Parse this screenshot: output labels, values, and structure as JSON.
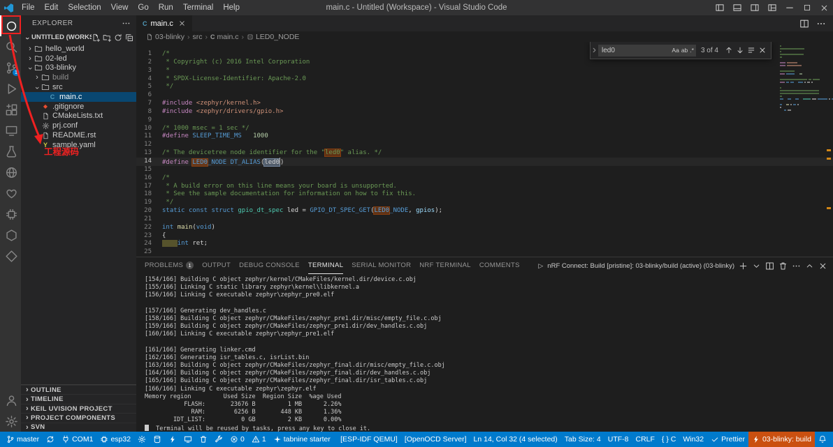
{
  "colors": {
    "statusbar_background": "#007acc",
    "build_badge_background": "#ca5010",
    "annotation_red": "#f02121",
    "activity_badge_blue": "#007acc",
    "find_current_match": "#515c6a",
    "find_match_orange": "rgba(234,92,0,0.33)",
    "selected_row_blue": "#094771"
  },
  "title_bar": {
    "app_title": "main.c - Untitled (Workspace) - Visual Studio Code",
    "menus": [
      "File",
      "Edit",
      "Selection",
      "View",
      "Go",
      "Run",
      "Terminal",
      "Help"
    ]
  },
  "activity_bar": {
    "top": [
      {
        "name": "explorer",
        "active": true
      },
      {
        "name": "search"
      },
      {
        "name": "source-control",
        "badge": "1"
      },
      {
        "name": "run-debug"
      },
      {
        "name": "extensions"
      },
      {
        "name": "remote-explorer"
      },
      {
        "name": "test-beaker"
      },
      {
        "name": "nrf-connect"
      },
      {
        "name": "platformio"
      },
      {
        "name": "device-chip"
      },
      {
        "name": "keil"
      },
      {
        "name": "kite"
      }
    ],
    "bottom": [
      {
        "name": "accounts"
      },
      {
        "name": "settings-gear"
      }
    ]
  },
  "sidebar": {
    "title": "EXPLORER",
    "workspace_label": "UNTITLED (WORKSPACE)",
    "tree": [
      {
        "label": "hello_world",
        "indent": 0,
        "kind": "folder",
        "expanded": false
      },
      {
        "label": "02-led",
        "indent": 0,
        "kind": "folder",
        "expanded": false
      },
      {
        "label": "03-blinky",
        "indent": 0,
        "kind": "folder",
        "expanded": true
      },
      {
        "label": "build",
        "indent": 1,
        "kind": "folder",
        "expanded": false,
        "dim": true
      },
      {
        "label": "src",
        "indent": 1,
        "kind": "folder",
        "expanded": true
      },
      {
        "label": "main.c",
        "indent": 2,
        "kind": "c",
        "selected": true
      },
      {
        "label": ".gitignore",
        "indent": 1,
        "kind": "git"
      },
      {
        "label": "CMakeLists.txt",
        "indent": 1,
        "kind": "doc"
      },
      {
        "label": "prj.conf",
        "indent": 1,
        "kind": "conf"
      },
      {
        "label": "README.rst",
        "indent": 1,
        "kind": "doc"
      },
      {
        "label": "sample.yaml",
        "indent": 1,
        "kind": "yaml"
      }
    ],
    "sections": [
      "OUTLINE",
      "TIMELINE",
      "KEIL UVISION PROJECT",
      "PROJECT COMPONENTS",
      "SVN"
    ]
  },
  "annotation": {
    "label": "工程源码"
  },
  "editor": {
    "tab": {
      "label": "main.c"
    },
    "breadcrumbs": [
      "03-blinky",
      "src",
      "main.c",
      "LED0_NODE"
    ],
    "find": {
      "value": "led0",
      "results": "3 of 4",
      "toggles": [
        "Aa",
        "ab",
        ".*"
      ]
    },
    "code": [
      {
        "n": 1,
        "s": [
          [
            "/*",
            "cm"
          ]
        ]
      },
      {
        "n": 2,
        "s": [
          [
            " * Copyright (c) 2016 Intel Corporation",
            "cm"
          ]
        ]
      },
      {
        "n": 3,
        "s": [
          [
            " *",
            "cm"
          ]
        ]
      },
      {
        "n": 4,
        "s": [
          [
            " * SPDX-License-Identifier: Apache-2.0",
            "cm"
          ]
        ]
      },
      {
        "n": 5,
        "s": [
          [
            " */",
            "cm"
          ]
        ]
      },
      {
        "n": 6,
        "s": []
      },
      {
        "n": 7,
        "s": [
          [
            "#include ",
            "pp"
          ],
          [
            "<zephyr/kernel.h>",
            "str"
          ]
        ]
      },
      {
        "n": 8,
        "s": [
          [
            "#include ",
            "pp"
          ],
          [
            "<zephyr/drivers/gpio.h>",
            "str"
          ]
        ]
      },
      {
        "n": 9,
        "s": []
      },
      {
        "n": 10,
        "s": [
          [
            "/* 1000 msec = 1 sec */",
            "cm"
          ]
        ]
      },
      {
        "n": 11,
        "s": [
          [
            "#define ",
            "pp"
          ],
          [
            "SLEEP_TIME_MS",
            "mac"
          ],
          [
            "   ",
            "pl"
          ],
          [
            "1000",
            "num"
          ]
        ]
      },
      {
        "n": 12,
        "s": []
      },
      {
        "n": 13,
        "s": [
          [
            "/* The devicetree node identifier for the \"",
            "cm"
          ],
          [
            "led0",
            "cm match"
          ],
          [
            "\" alias. */",
            "cm"
          ]
        ]
      },
      {
        "n": 14,
        "cur": true,
        "s": [
          [
            "#define ",
            "pp"
          ],
          [
            "LED0",
            "mac match"
          ],
          [
            "_NODE",
            "mac"
          ],
          [
            " ",
            "pl"
          ],
          [
            "DT_ALIAS",
            "mac"
          ],
          [
            "(",
            "pl"
          ],
          [
            "led0",
            "pl cursel"
          ],
          [
            ")",
            "pl"
          ]
        ]
      },
      {
        "n": 15,
        "s": []
      },
      {
        "n": 16,
        "s": [
          [
            "/*",
            "cm"
          ]
        ]
      },
      {
        "n": 17,
        "s": [
          [
            " * A build error on this line means your board is unsupported.",
            "cm"
          ]
        ]
      },
      {
        "n": 18,
        "s": [
          [
            " * See the sample documentation for information on how to fix this.",
            "cm"
          ]
        ]
      },
      {
        "n": 19,
        "s": [
          [
            " */",
            "cm"
          ]
        ]
      },
      {
        "n": 20,
        "s": [
          [
            "static",
            "kw"
          ],
          [
            " ",
            "pl"
          ],
          [
            "const",
            "kw"
          ],
          [
            " ",
            "pl"
          ],
          [
            "struct",
            "kw"
          ],
          [
            " ",
            "pl"
          ],
          [
            "gpio_dt_spec",
            "typ"
          ],
          [
            " led = ",
            "pl"
          ],
          [
            "GPIO_DT_SPEC_GET",
            "mac"
          ],
          [
            "(",
            "pl"
          ],
          [
            "LED0",
            "mac match"
          ],
          [
            "_NODE",
            "mac"
          ],
          [
            ", ",
            "pl"
          ],
          [
            "gpios",
            "var"
          ],
          [
            ");",
            "pl"
          ]
        ]
      },
      {
        "n": 21,
        "s": []
      },
      {
        "n": 22,
        "s": [
          [
            "int",
            "kw"
          ],
          [
            " ",
            "pl"
          ],
          [
            "main",
            "fn"
          ],
          [
            "(",
            "pl"
          ],
          [
            "void",
            "kw"
          ],
          [
            ")",
            "pl"
          ]
        ]
      },
      {
        "n": 23,
        "s": [
          [
            "{",
            "pl"
          ]
        ]
      },
      {
        "n": 24,
        "s": [
          [
            "    ",
            "ws"
          ],
          [
            "int",
            "kw"
          ],
          [
            " ret;",
            "pl"
          ]
        ]
      },
      {
        "n": 25,
        "s": []
      }
    ]
  },
  "panel": {
    "tabs": [
      {
        "label": "PROBLEMS",
        "badge": "1"
      },
      {
        "label": "OUTPUT"
      },
      {
        "label": "DEBUG CONSOLE"
      },
      {
        "label": "TERMINAL",
        "active": true
      },
      {
        "label": "SERIAL MONITOR"
      },
      {
        "label": "NRF TERMINAL"
      },
      {
        "label": "COMMENTS"
      }
    ],
    "terminal_title": "nRF Connect: Build [pristine]: 03-blinky/build (active) (03-blinky)",
    "terminal_lines": [
      "[154/166] Building C object zephyr/kernel/CMakeFiles/kernel.dir/device.c.obj",
      "[155/166] Linking C static library zephyr\\kernel\\libkernel.a",
      "[156/166] Linking C executable zephyr\\zephyr_pre0.elf",
      "",
      "[157/166] Generating dev_handles.c",
      "[158/166] Building C object zephyr/CMakeFiles/zephyr_pre1.dir/misc/empty_file.c.obj",
      "[159/166] Building C object zephyr/CMakeFiles/zephyr_pre1.dir/dev_handles.c.obj",
      "[160/166] Linking C executable zephyr\\zephyr_pre1.elf",
      "",
      "[161/166] Generating linker.cmd",
      "[162/166] Generating isr_tables.c, isrList.bin",
      "[163/166] Building C object zephyr/CMakeFiles/zephyr_final.dir/misc/empty_file.c.obj",
      "[164/166] Building C object zephyr/CMakeFiles/zephyr_final.dir/dev_handles.c.obj",
      "[165/166] Building C object zephyr/CMakeFiles/zephyr_final.dir/isr_tables.c.obj",
      "[166/166] Linking C executable zephyr\\zephyr.elf",
      "Memory region         Used Size  Region Size  %age Used",
      "           FLASH:       23676 B         1 MB      2.26%",
      "             RAM:        6256 B       448 KB      1.36%",
      "        IDT_LIST:          0 GB         2 KB      0.00%"
    ],
    "cursor_line": "Terminal will be reused by tasks, press any key to close it."
  },
  "status_bar": {
    "left": [
      {
        "name": "scm-branch",
        "icon": "branch",
        "label": "master"
      },
      {
        "name": "sync",
        "icon": "sync"
      },
      {
        "name": "serial-port",
        "icon": "plug",
        "label": "COM1"
      },
      {
        "name": "esp-target",
        "icon": "chip",
        "label": "esp32"
      },
      {
        "name": "esp-settings",
        "icon": "gear"
      },
      {
        "name": "esp-build",
        "icon": "database"
      },
      {
        "name": "esp-flash",
        "icon": "lightning"
      },
      {
        "name": "esp-monitor",
        "icon": "monitor"
      },
      {
        "name": "esp-clean",
        "icon": "trash"
      },
      {
        "name": "esp-tools",
        "icon": "wrench"
      },
      {
        "name": "problems-errors",
        "icon": "error",
        "label": "0"
      },
      {
        "name": "problems-warnings",
        "icon": "warning",
        "label": "1"
      },
      {
        "name": "tabnine",
        "icon": "spark",
        "label": "tabnine starter"
      }
    ],
    "right": [
      {
        "name": "esp-idf-qemu",
        "label": "[ESP-IDF QEMU]"
      },
      {
        "name": "openocd-server",
        "label": "[OpenOCD Server]"
      },
      {
        "name": "cursor-position",
        "label": "Ln 14, Col 32 (4 selected)"
      },
      {
        "name": "indentation",
        "label": "Tab Size: 4"
      },
      {
        "name": "encoding",
        "label": "UTF-8"
      },
      {
        "name": "eol",
        "label": "CRLF"
      },
      {
        "name": "language-mode",
        "label": "{ } C"
      },
      {
        "name": "platform",
        "label": "Win32"
      },
      {
        "name": "prettier",
        "icon": "check",
        "label": "Prettier"
      },
      {
        "name": "nrf-build",
        "icon": "lightning",
        "label": "03-blinky: build",
        "badge": true
      },
      {
        "name": "notifications",
        "icon": "bell"
      }
    ]
  }
}
